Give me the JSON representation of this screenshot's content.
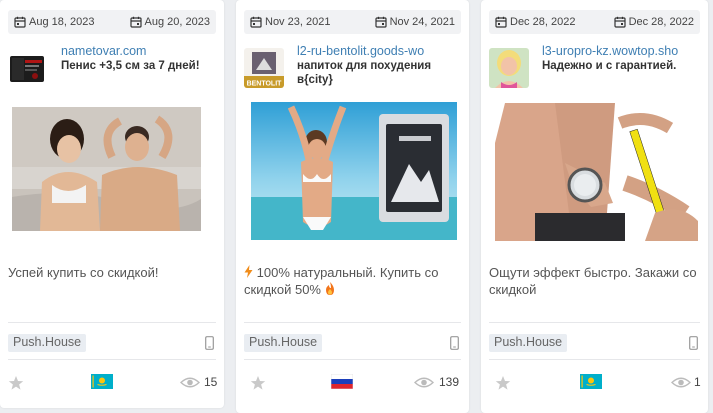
{
  "cards": [
    {
      "date_start": "Aug 18, 2023",
      "date_end": "Aug 20, 2023",
      "domain": "nametovar.com",
      "title": "Пенис +3,5 см за 7 дней!",
      "text": "Успей купить со скидкой!",
      "network": "Push.House",
      "device_icon": "smartphone-icon",
      "flag": "Kazakhstan",
      "views": "15"
    },
    {
      "date_start": "Nov 23, 2021",
      "date_end": "Nov 24, 2021",
      "domain": "l2-ru-bentolit.goods-wo",
      "title": "напиток для похудения в{city}",
      "text_icon": "lightning-icon",
      "text": "100% натуральный. Купить со скидкой 50%",
      "text_icon_end": "fire-icon",
      "icon_label": "BENTOLIT",
      "network": "Push.House",
      "device_icon": "smartphone-icon",
      "flag": "Russia",
      "views": "139"
    },
    {
      "date_start": "Dec 28, 2022",
      "date_end": "Dec 28, 2022",
      "domain": "l3-uropro-kz.wowtop.sho",
      "title": "Надежно и с гарантией.",
      "text": "Ощути эффект быстро. Закажи со скидкой",
      "network": "Push.House",
      "device_icon": "smartphone-icon",
      "flag": "Kazakhstan",
      "views": "1"
    }
  ],
  "colors": {
    "link": "#3f7fb3",
    "page_bg": "#eceef1",
    "badge_bg": "#e9edf2",
    "kz_flag": "#00afca",
    "kz_gold": "#fec50c"
  }
}
